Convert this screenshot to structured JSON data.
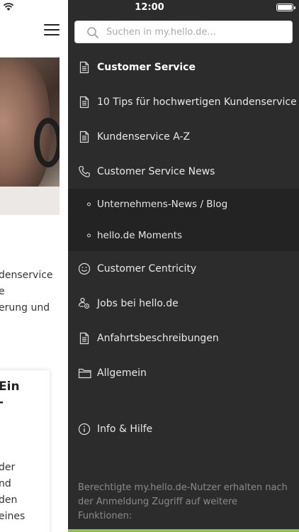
{
  "status": {
    "time": "12:00"
  },
  "background": {
    "text_lines": [
      "denservice",
      "e",
      "erung und"
    ],
    "card_title_lines": [
      "Ein",
      "-"
    ],
    "card_text_lines": [
      "der",
      "nd",
      "den",
      "eines"
    ]
  },
  "search": {
    "placeholder": "Suchen in my.hello.de..."
  },
  "menu": {
    "items": [
      {
        "label": "Customer Service",
        "icon": "document-icon"
      },
      {
        "label": "10 Tips für hochwertigen Kundenservice",
        "icon": "document-icon"
      },
      {
        "label": "Kundenservice A-Z",
        "icon": "document-icon"
      },
      {
        "label": "Customer Service News",
        "icon": "phone-icon"
      }
    ],
    "sub_items": [
      {
        "label": "Unternehmens-News / Blog"
      },
      {
        "label": "hello.de Moments"
      }
    ],
    "items2": [
      {
        "label": "Customer Centricity",
        "icon": "smiley-icon"
      },
      {
        "label": "Jobs bei hello.de",
        "icon": "jobs-icon"
      },
      {
        "label": "Anfahrtsbeschreibungen",
        "icon": "document-icon"
      },
      {
        "label": "Allgemein",
        "icon": "folder-icon"
      }
    ],
    "info": {
      "label": "Info & Hilfe",
      "icon": "info-icon"
    }
  },
  "footer": {
    "note": "Berechtigte my.hello.de-Nutzer erhalten nach der Anmeldung Zugriff auf weitere Funktionen:"
  },
  "colors": {
    "drawer_bg": "#2c2c2c",
    "sub_bg": "#232323",
    "accent": "#8bc53f"
  }
}
